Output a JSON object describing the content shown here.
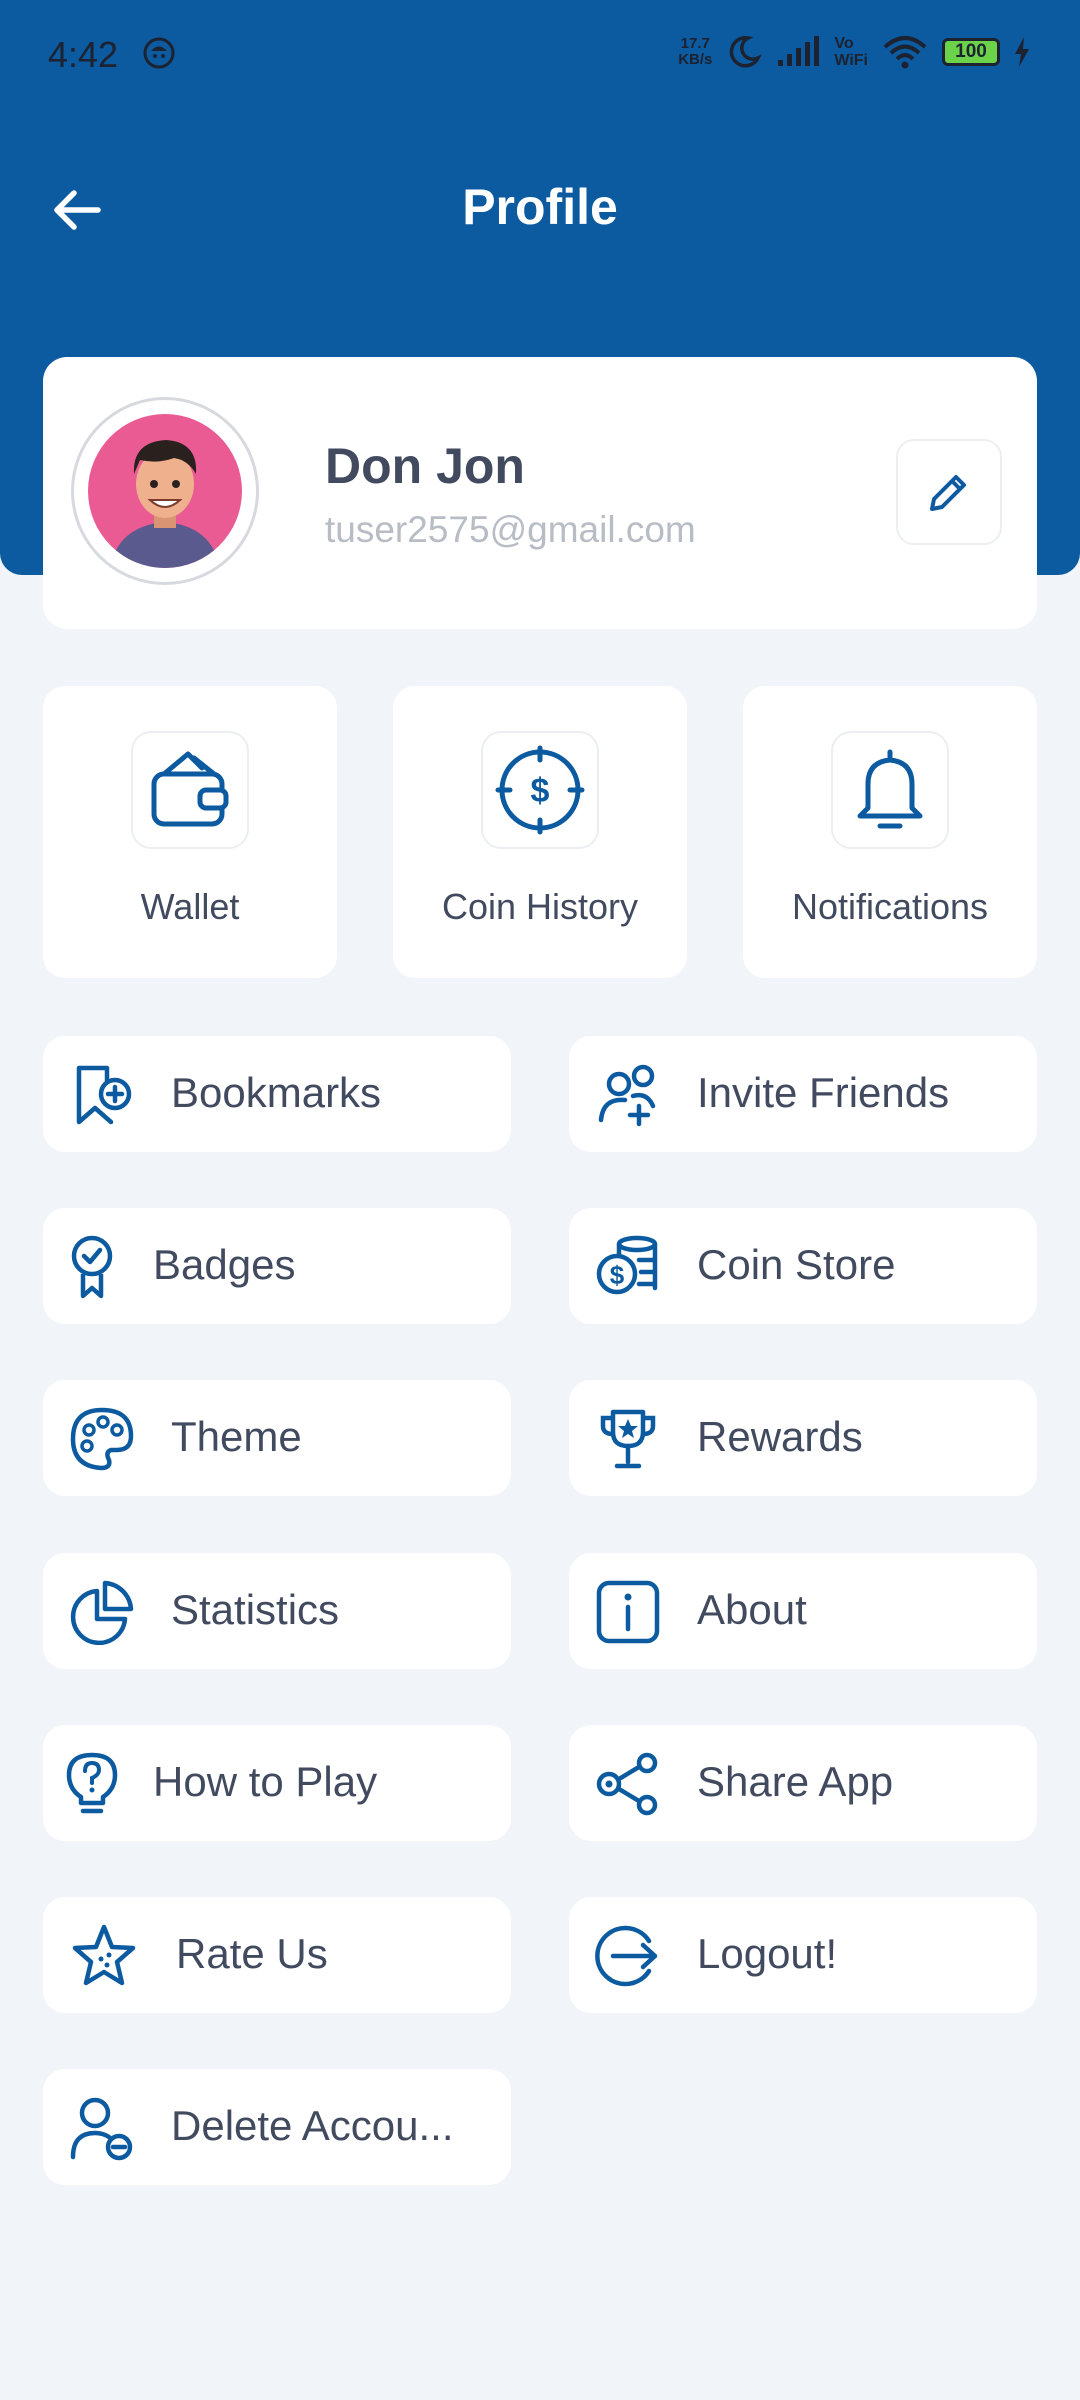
{
  "status_bar": {
    "time": "4:42",
    "net_speed_value": "17.7",
    "net_speed_unit": "KB/s",
    "vowifi_top": "Vo",
    "vowifi_bottom": "WiFi",
    "battery": "100"
  },
  "header": {
    "title": "Profile"
  },
  "profile": {
    "name": "Don Jon",
    "email": "tuser2575@gmail.com"
  },
  "tiles": [
    {
      "label": "Wallet",
      "icon": "wallet-icon"
    },
    {
      "label": "Coin History",
      "icon": "coin-history-icon"
    },
    {
      "label": "Notifications",
      "icon": "bell-icon"
    }
  ],
  "menu": {
    "bookmarks": "Bookmarks",
    "invite_friends": "Invite Friends",
    "badges": "Badges",
    "coin_store": "Coin Store",
    "theme": "Theme",
    "rewards": "Rewards",
    "statistics": "Statistics",
    "about": "About",
    "how_to_play": "How to Play",
    "share_app": "Share App",
    "rate_us": "Rate Us",
    "logout": "Logout!",
    "delete_account": "Delete Accou..."
  },
  "colors": {
    "primary": "#0c5aa0",
    "icon": "#0c5aa0",
    "background": "#f1f4f8",
    "card": "#ffffff",
    "avatar_bg": "#ea5b93"
  }
}
